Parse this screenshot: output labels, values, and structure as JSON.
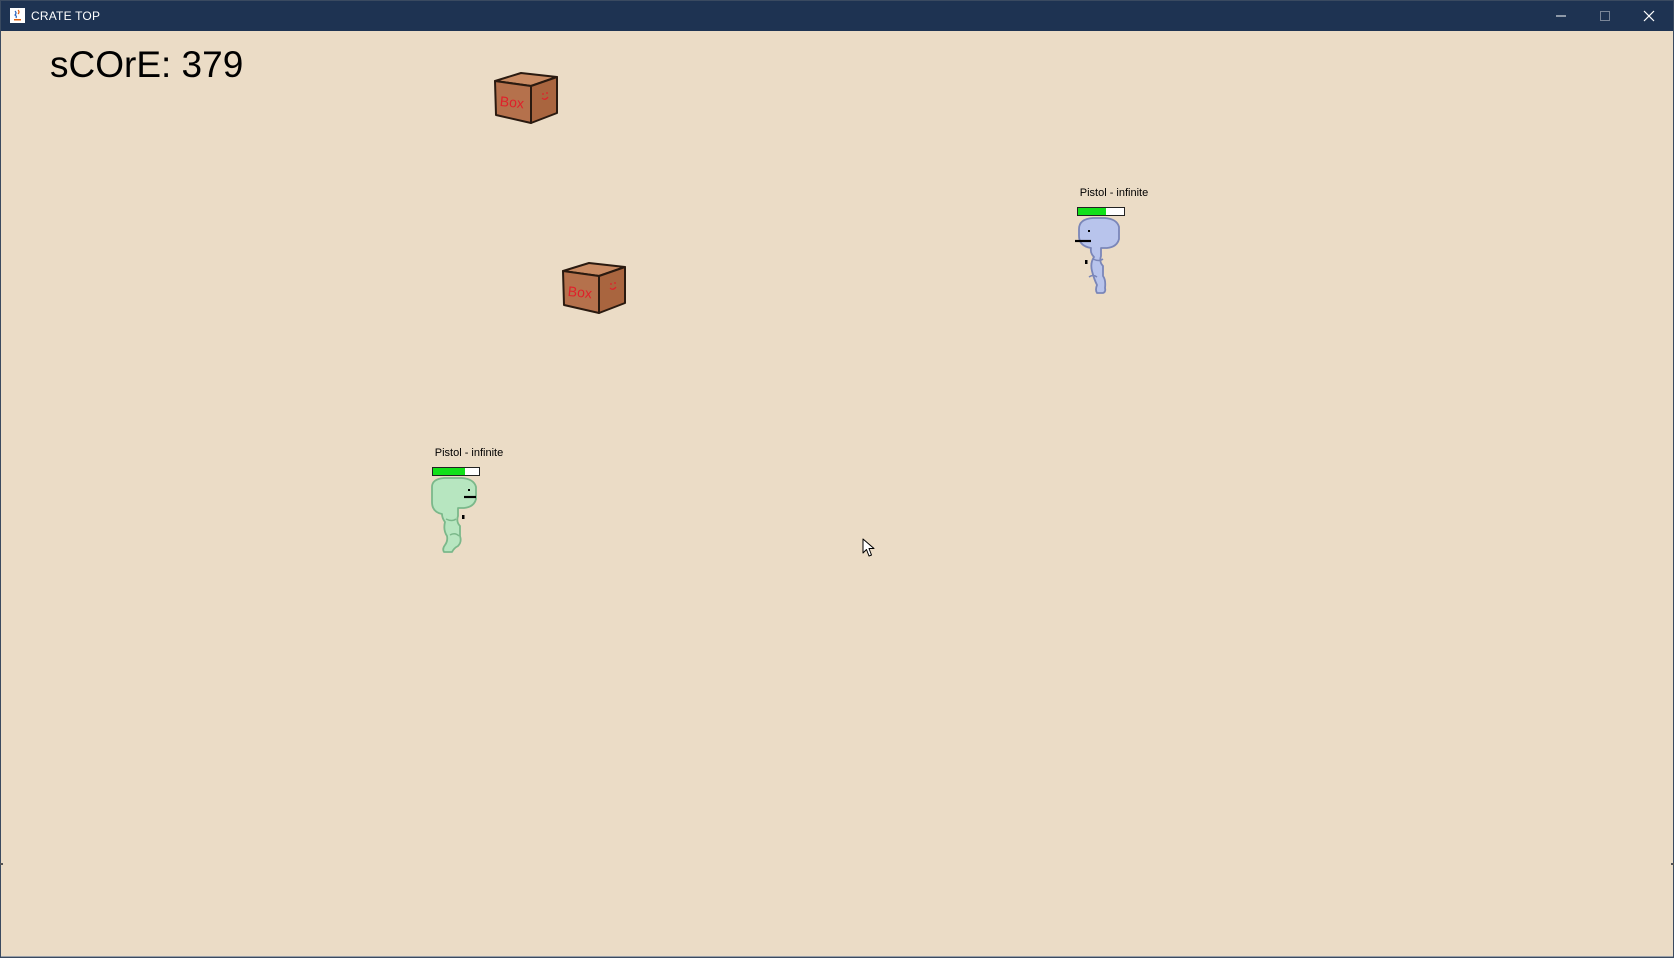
{
  "window": {
    "title": "CRATE TOP",
    "controls": {
      "minimize_icon": "minimize-icon",
      "maximize_icon": "maximize-icon",
      "close_icon": "close-icon"
    }
  },
  "hud": {
    "score_text": "sCOrE: 379"
  },
  "crates": [
    {
      "label": "Box"
    },
    {
      "label": "Box"
    }
  ],
  "players": [
    {
      "color": "#b8c4ec",
      "weapon_label": "Pistol - infinite",
      "health_fraction": 0.6
    },
    {
      "color": "#b7e6c0",
      "weapon_label": "Pistol - infinite",
      "health_fraction": 0.7
    }
  ],
  "colors": {
    "titlebar": "#1e3352",
    "background": "#ebdcc6",
    "crate": "#b5714c",
    "crate_text": "#e0202a",
    "health": "#12e01a"
  }
}
